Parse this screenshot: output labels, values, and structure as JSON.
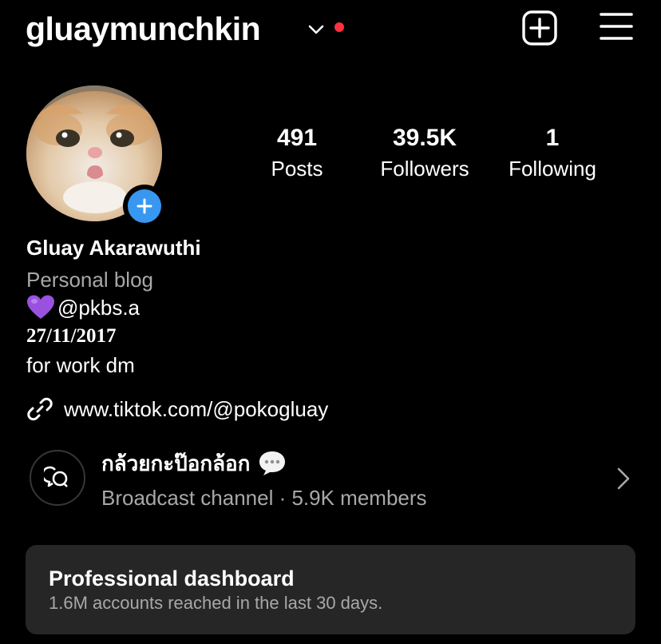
{
  "header": {
    "username": "gluaymunchkin",
    "notification_dot_color": "#ff3040",
    "icons": [
      "chevron-down-icon",
      "add-post-icon",
      "hamburger-menu-icon"
    ]
  },
  "stats": [
    {
      "count": "491",
      "label": "Posts"
    },
    {
      "count": "39.5K",
      "label": "Followers"
    },
    {
      "count": "1",
      "label": "Following"
    }
  ],
  "profile": {
    "full_name": "Gluay Akarawuthi",
    "category": "Personal blog",
    "mention": "@pkbs.a",
    "mention_icon": "purple-heart-icon",
    "bio_date": "27/11/2017",
    "bio_line": "for work dm",
    "link": "www.tiktok.com/@pokogluay"
  },
  "broadcast": {
    "title": "กล้วยกะป๊อกล้อก",
    "title_icon": "speech-bubble-icon",
    "subtitle": "Broadcast channel · 5.9K members"
  },
  "dashboard": {
    "title": "Professional dashboard",
    "subtitle": "1.6M accounts reached in the last 30 days."
  },
  "colors": {
    "background": "#000000",
    "accent_blue": "#3897f0",
    "card": "#262626",
    "secondary_text": "#a8a8a8"
  }
}
